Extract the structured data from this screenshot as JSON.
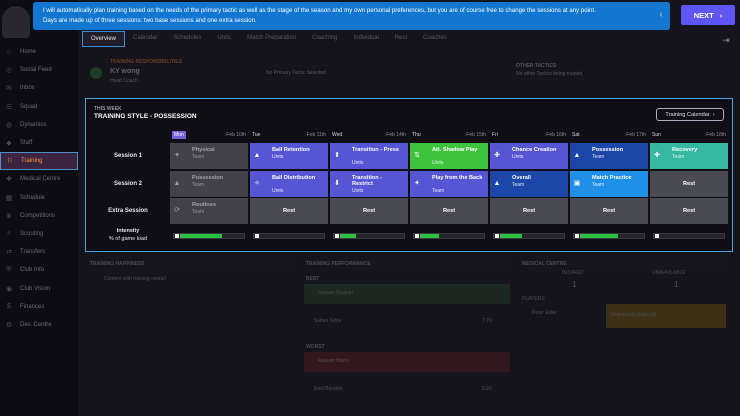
{
  "banner": {
    "line1": "I will automatically plan training based on the needs of the primary tactic as well as the stage of the season and my own personal preferences, but you are of course free to change the sessions at any point.",
    "line2": "Days are made up of three sessions: two base sessions and one extra session.",
    "prev_icon": "‹",
    "next_label": "NEXT",
    "next_icon": "›"
  },
  "sidebar": {
    "items": [
      {
        "label": "Home",
        "icon": "home-icon"
      },
      {
        "label": "Social Feed",
        "icon": "social-icon"
      },
      {
        "label": "Inbox",
        "icon": "inbox-icon"
      },
      {
        "label": "Squad",
        "icon": "squad-icon"
      },
      {
        "label": "Dynamics",
        "icon": "dynamics-icon"
      },
      {
        "label": "Staff",
        "icon": "staff-icon"
      },
      {
        "label": "Training",
        "icon": "training-icon"
      },
      {
        "label": "Medical Centre",
        "icon": "medical-icon"
      },
      {
        "label": "Schedule",
        "icon": "schedule-icon"
      },
      {
        "label": "Competitions",
        "icon": "trophy-icon"
      },
      {
        "label": "Scouting",
        "icon": "scouting-icon"
      },
      {
        "label": "Transfers",
        "icon": "transfers-icon"
      },
      {
        "label": "Club Info",
        "icon": "club-icon"
      },
      {
        "label": "Club Vision",
        "icon": "vision-icon"
      },
      {
        "label": "Finances",
        "icon": "finances-icon"
      },
      {
        "label": "Dev. Centre",
        "icon": "dev-icon"
      }
    ]
  },
  "tabs": [
    "Overview",
    "Calendar",
    "Schedules",
    "Units",
    "Match Preparation",
    "Coaching",
    "Individual",
    "Rest",
    "Coaches"
  ],
  "top_info": {
    "label": "TRAINING RESPONSIBILITIES",
    "manager": "KY wong",
    "role": "Head Coach",
    "primary": "No Primary Tactic Selected",
    "other_title": "OTHER TACTICS",
    "other_text": "No other Tactics being trained"
  },
  "panel": {
    "this_week": "THIS WEEK",
    "title": "TRAINING STYLE - POSSESSION",
    "calendar_button": "Training Calendar",
    "calendar_icon": "›",
    "days": [
      {
        "name": "Mon",
        "date": "Feb 10th",
        "today": true
      },
      {
        "name": "Tue",
        "date": "Feb 11th",
        "today": false
      },
      {
        "name": "Wed",
        "date": "Feb 14th",
        "today": false
      },
      {
        "name": "Thu",
        "date": "Feb 15th",
        "today": false
      },
      {
        "name": "Fri",
        "date": "Feb 16th",
        "today": false
      },
      {
        "name": "Sat",
        "date": "Feb 17th",
        "today": false
      },
      {
        "name": "Sun",
        "date": "Feb 18th",
        "today": false
      }
    ],
    "row_labels": [
      "Session 1",
      "Session 2",
      "Extra Session"
    ],
    "intensity_label_1": "Intensity",
    "intensity_label_2": "% of game load",
    "sessions": [
      [
        {
          "name": "Physical",
          "sub": "Team",
          "color": "#67656e",
          "icon": "physical-icon",
          "glyph": "✦",
          "faded": true
        },
        {
          "name": "Ball Retention",
          "sub": "Units",
          "color": "#5656d4",
          "icon": "ball-retention-icon",
          "glyph": "▲"
        },
        {
          "name": "Transition - Press",
          "sub": "Units",
          "color": "#5656d4",
          "icon": "press-icon",
          "glyph": "⬆"
        },
        {
          "name": "Att. Shadow Play",
          "sub": "Units",
          "color": "#3ec33c",
          "icon": "shadow-play-icon",
          "glyph": "⇅"
        },
        {
          "name": "Chance Creation",
          "sub": "Units",
          "color": "#5656d4",
          "icon": "chance-creation-icon",
          "glyph": "✚"
        },
        {
          "name": "Possession",
          "sub": "Team",
          "color": "#1c46a8",
          "icon": "possession-icon",
          "glyph": "▲"
        },
        {
          "name": "Recovery",
          "sub": "Team",
          "color": "#37b8a0",
          "icon": "recovery-icon",
          "glyph": "✚"
        }
      ],
      [
        {
          "name": "Possession",
          "sub": "Team",
          "color": "#67656e",
          "icon": "possession-icon",
          "glyph": "▲",
          "faded": true
        },
        {
          "name": "Ball Distribution",
          "sub": "Units",
          "color": "#5656d4",
          "icon": "distribution-icon",
          "glyph": "✧"
        },
        {
          "name": "Transition - Restrict",
          "sub": "Units",
          "color": "#5656d4",
          "icon": "restrict-icon",
          "glyph": "⬇"
        },
        {
          "name": "Play from the Back",
          "sub": "Team",
          "color": "#5656d4",
          "icon": "play-back-icon",
          "glyph": "✦"
        },
        {
          "name": "Overall",
          "sub": "Team",
          "color": "#1c46a8",
          "icon": "overall-icon",
          "glyph": "▲"
        },
        {
          "name": "Match Practice",
          "sub": "Team",
          "color": "#1f8fe8",
          "icon": "match-practice-icon",
          "glyph": "▣"
        },
        {
          "name": "Rest",
          "sub": "",
          "color": "#4a4a52",
          "rest": true
        }
      ],
      [
        {
          "name": "Routines",
          "sub": "Team",
          "color": "#67656e",
          "icon": "routines-icon",
          "glyph": "⟳",
          "faded": true
        },
        {
          "name": "Rest",
          "sub": "",
          "color": "#4a4a52",
          "rest": true
        },
        {
          "name": "Rest",
          "sub": "",
          "color": "#4a4a52",
          "rest": true
        },
        {
          "name": "Rest",
          "sub": "",
          "color": "#4a4a52",
          "rest": true
        },
        {
          "name": "Rest",
          "sub": "",
          "color": "#4a4a52",
          "rest": true
        },
        {
          "name": "Rest",
          "sub": "",
          "color": "#4a4a52",
          "rest": true
        },
        {
          "name": "Rest",
          "sub": "",
          "color": "#4a4a52",
          "rest": true
        }
      ]
    ],
    "intensity": [
      0.65,
      0.0,
      0.25,
      0.3,
      0.35,
      0.6,
      0.0
    ]
  },
  "lower": {
    "happiness_title": "TRAINING HAPPINESS",
    "happiness_text": "Content with training overall",
    "performance_title": "TRAINING PERFORMANCE",
    "best_label": "BEST",
    "worst_label": "WORST",
    "best_player": "Hassan Baskan",
    "best_player2": "Sultan Girisi",
    "best_value": "7.70",
    "worst_player": "Rasyan Marin",
    "worst_player2": "Emil Borodin",
    "worst_value": "5.20",
    "medical_title": "MEDICAL CENTRE",
    "injured_label": "INJURED",
    "injured_value": "1",
    "unavailable_label": "UNAVAILABLE",
    "unavailable_value": "1",
    "players_label": "PLAYERS",
    "injured_player": "Peter Elder",
    "status": "Unavailable (Injured)"
  }
}
